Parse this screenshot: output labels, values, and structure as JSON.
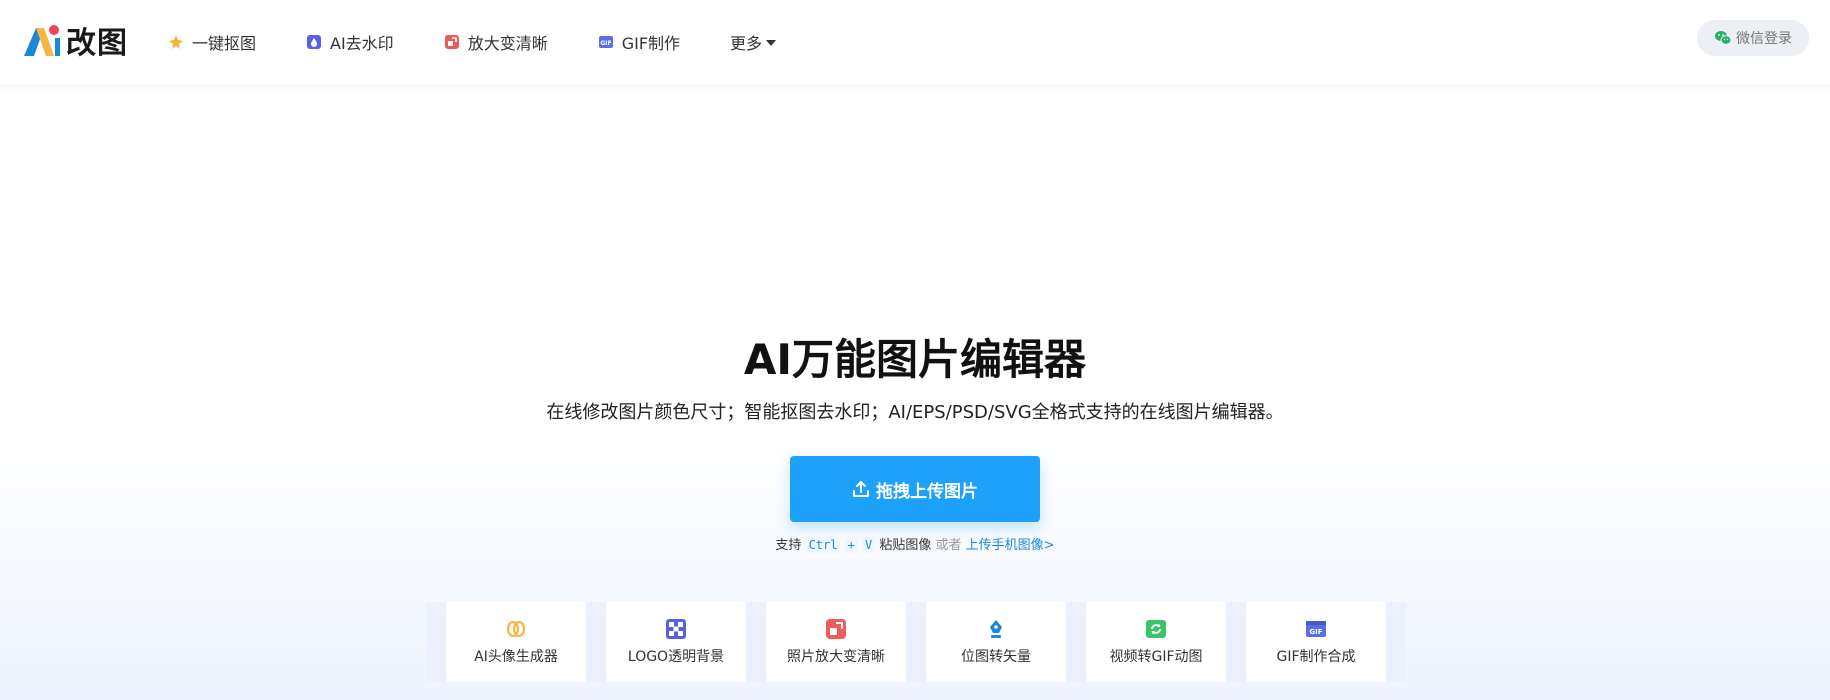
{
  "brand": {
    "name": "改图",
    "logo_letter": "A"
  },
  "nav": [
    {
      "label": "一键抠图",
      "icon": "star-sparkle-icon",
      "color": "#f5b642"
    },
    {
      "label": "AI去水印",
      "icon": "drop-icon",
      "color": "#5a5ee8"
    },
    {
      "label": "放大变清晰",
      "icon": "enlarge-icon",
      "color": "#f25b5b"
    },
    {
      "label": "GIF制作",
      "icon": "gif-icon",
      "color": "#5a6ee8"
    },
    {
      "label": "更多"
    }
  ],
  "login": {
    "label": "微信登录",
    "icon": "wechat-icon",
    "color": "#2aae67"
  },
  "hero": {
    "title": "AI万能图片编辑器",
    "subtitle": "在线修改图片颜色尺寸；智能抠图去水印；AI/EPS/PSD/SVG全格式支持的在线图片编辑器。",
    "upload_label": "拖拽上传图片"
  },
  "hint": {
    "prefix": "支持",
    "key1": "Ctrl",
    "plus": "+",
    "key2": "V",
    "paste": "粘贴图像",
    "or": "或者",
    "mobile_link": "上传手机图像>"
  },
  "tools": [
    {
      "label": "AI头像生成器",
      "icon": "avatar-rings-icon",
      "color": "#f0b84a"
    },
    {
      "label": "LOGO透明背景",
      "icon": "checker-icon",
      "color": "#5a5ee8"
    },
    {
      "label": "照片放大变清晰",
      "icon": "enlarge-icon",
      "color": "#f25b5b"
    },
    {
      "label": "位图转矢量",
      "icon": "pen-nib-icon",
      "color": "#1a8ad8"
    },
    {
      "label": "视频转GIF动图",
      "icon": "video-convert-icon",
      "color": "#3cc46a"
    },
    {
      "label": "GIF制作合成",
      "icon": "gif-icon",
      "color": "#5a6ee8"
    }
  ]
}
